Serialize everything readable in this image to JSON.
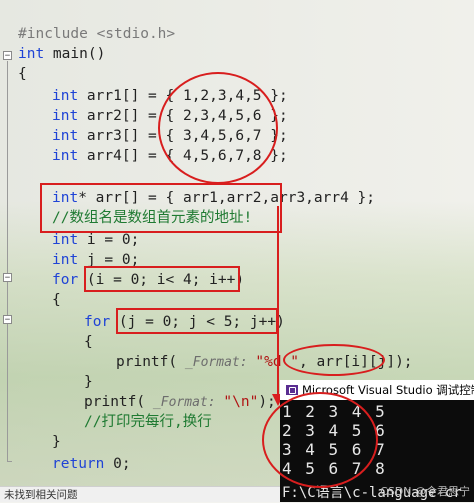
{
  "code": {
    "include": "#include <stdio.h>",
    "main_sig": "int main()",
    "open_brace": "{",
    "arr1": "int arr1[] = { 1,2,3,4,5 };",
    "arr2": "int arr2[] = { 2,3,4,5,6 };",
    "arr3": "int arr3[] = { 3,4,5,6,7 };",
    "arr4": "int arr4[] = { 4,5,6,7,8 };",
    "ptr_arr": "int* arr[] = { arr1,arr2,arr3,arr4 };",
    "comment1": "//数组名是数组首元素的地址!",
    "decl_i": "int i = 0;",
    "decl_j": "int j = 0;",
    "for_i": "for (i = 0; i< 4; i++)",
    "brace_i_open": "{",
    "for_j": "for (j = 0; j < 5; j++)",
    "brace_j_open": "{",
    "printf1_pre": "printf(",
    "printf1_param": "_Format:",
    "printf1_fmt": "\"%d \"",
    "printf1_arg": "arr[i][j]",
    "printf1_end": ");",
    "brace_j_close": "}",
    "printf2_pre": "printf(",
    "printf2_param": "_Format:",
    "printf2_fmt": "\"\\n\"",
    "printf2_end": ");",
    "comment2": "//打印完每行,换行",
    "brace_i_close": "}",
    "ret": "return 0;"
  },
  "console": {
    "title": "Microsoft Visual Studio 调试控制台",
    "rows": [
      "1 2 3 4 5",
      "2 3 4 5 6",
      "3 4 5 6 7",
      "4 5 6 7 8"
    ],
    "path": "F:\\C语言\\c-language-cr"
  },
  "watermark": "CSDN @令君思宁",
  "status": "未找到相关问题",
  "colors": {
    "keyword": "#1f43d6",
    "string": "#b01414",
    "comment": "#1f7a32",
    "annotation": "#d81e1e",
    "console_bg": "#0c0c0c"
  }
}
